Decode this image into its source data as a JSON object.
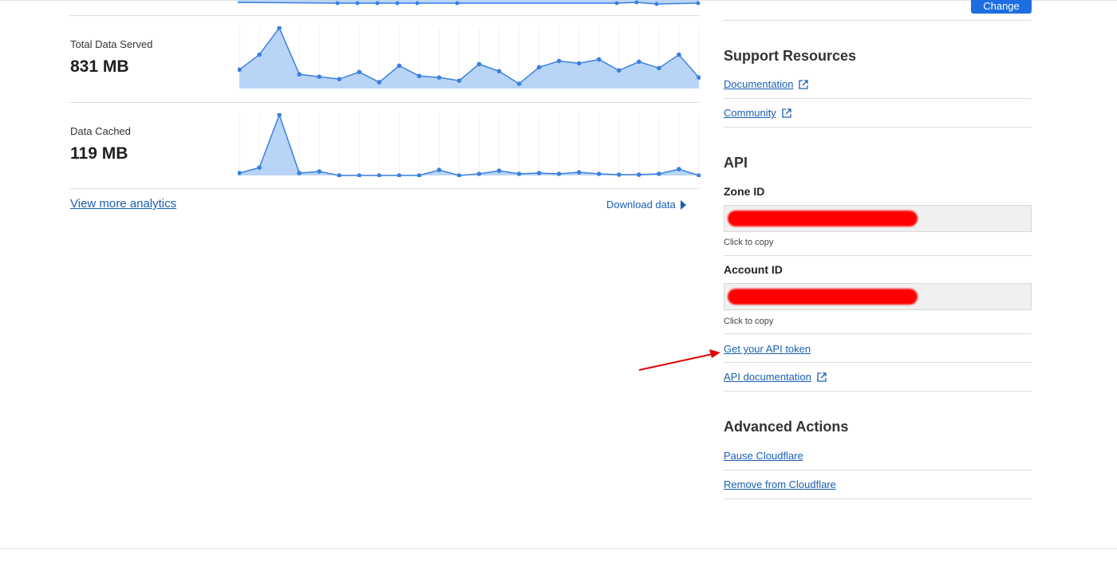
{
  "analytics": {
    "metrics": [
      {
        "label": "Total Data Served",
        "value": "831 MB",
        "series": [
          24,
          43,
          77,
          18,
          15,
          12,
          21,
          8,
          29,
          16,
          14,
          10,
          31,
          22,
          6,
          27,
          35,
          32,
          37,
          23,
          34,
          26,
          43,
          14
        ]
      },
      {
        "label": "Data Cached",
        "value": "119 MB",
        "series": [
          3,
          10,
          77,
          3,
          5,
          0,
          0,
          0,
          0,
          0,
          7,
          0,
          2,
          6,
          2,
          3,
          2,
          4,
          2,
          1,
          1,
          2,
          8,
          0
        ]
      }
    ],
    "view_more": "View more analytics",
    "download": "Download data"
  },
  "colors": {
    "line": "#3b7fe0",
    "fill": "#b8d4f7",
    "link": "#1a5fb4",
    "button": "#1d6ee0",
    "redaction": "#ff0000",
    "annotation_arrow": "#e00000"
  },
  "panel": {
    "change_button": "Change",
    "support": {
      "title": "Support Resources",
      "links": [
        "Documentation",
        "Community"
      ]
    },
    "api": {
      "title": "API",
      "zone_id_label": "Zone ID",
      "account_id_label": "Account ID",
      "copy_hint": "Click to copy",
      "token_link": "Get your API token",
      "docs_link": "API documentation"
    },
    "advanced": {
      "title": "Advanced Actions",
      "links": [
        "Pause Cloudflare",
        "Remove from Cloudflare"
      ]
    }
  }
}
